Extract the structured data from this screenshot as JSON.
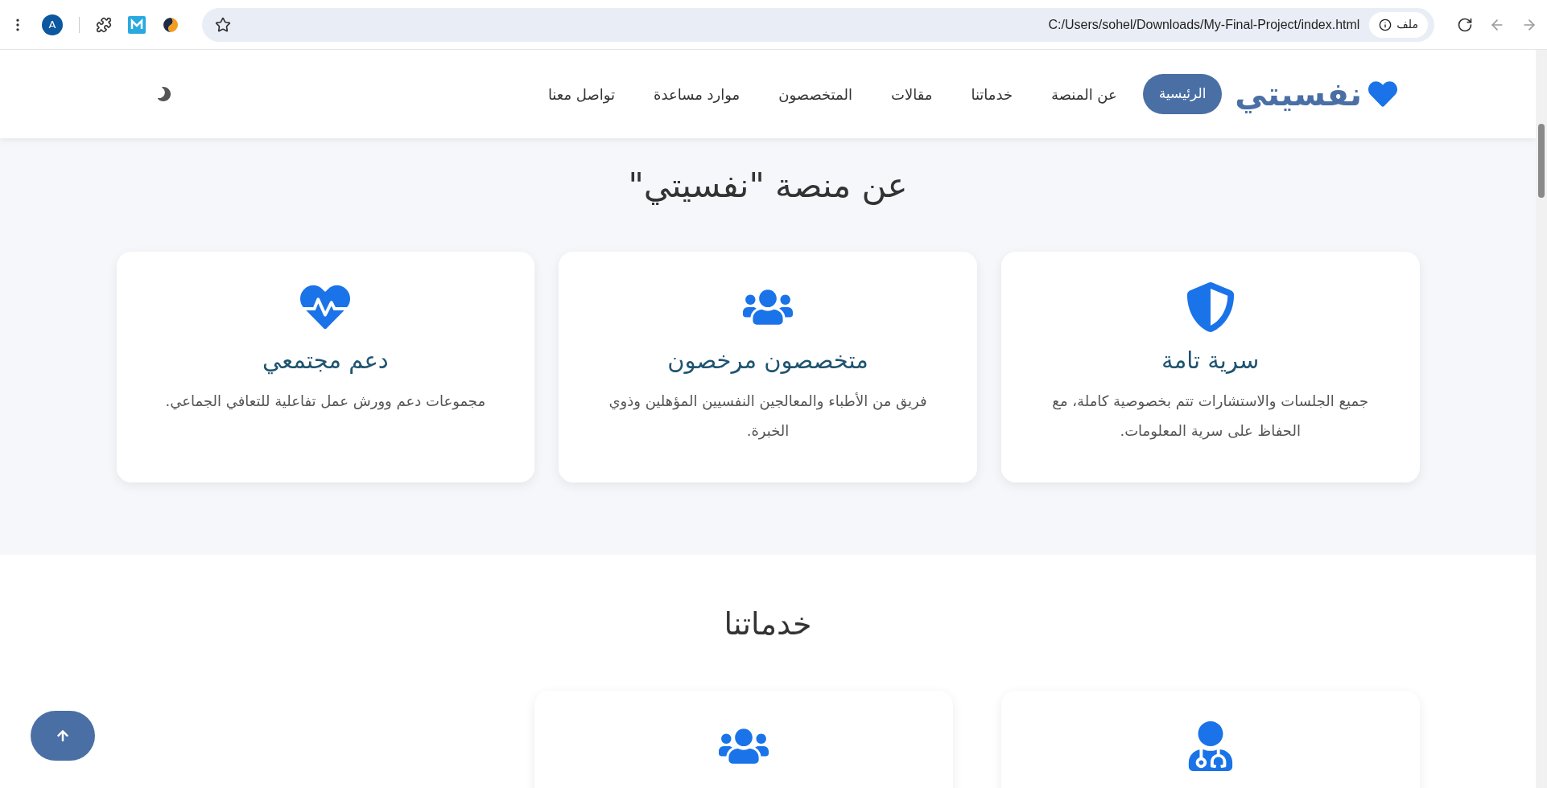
{
  "browser": {
    "profile_initial": "A",
    "url": "C:/Users/sohel/Downloads/My-Final-Project/index.html",
    "site_chip": "ملف"
  },
  "nav": {
    "logo": "نفسيتي",
    "items": [
      {
        "label": "الرئيسية",
        "selected": true
      },
      {
        "label": "عن المنصة",
        "selected": false
      },
      {
        "label": "خدماتنا",
        "selected": false
      },
      {
        "label": "مقالات",
        "selected": false
      },
      {
        "label": "المتخصصون",
        "selected": false
      },
      {
        "label": "موارد مساعدة",
        "selected": false
      },
      {
        "label": "تواصل معنا",
        "selected": false
      }
    ]
  },
  "about": {
    "title": "عن منصة \"نفسيتي\"",
    "cards": [
      {
        "title": "سرية تامة",
        "text": "جميع الجلسات والاستشارات تتم بخصوصية كاملة، مع الحفاظ على سرية المعلومات."
      },
      {
        "title": "متخصصون مرخصون",
        "text": "فريق من الأطباء والمعالجين النفسيين المؤهلين وذوي الخبرة."
      },
      {
        "title": "دعم مجتمعي",
        "text": "مجموعات دعم وورش عمل تفاعلية للتعافي الجماعي."
      }
    ]
  },
  "services": {
    "title": "خدماتنا"
  }
}
